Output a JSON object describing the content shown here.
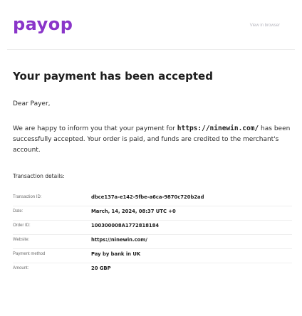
{
  "header": {
    "logo_text": "payop",
    "view_in_browser": "View in browser"
  },
  "title": "Your payment has been accepted",
  "greeting": "Dear Payer,",
  "message": {
    "part1": "We are happy to inform you that your payment for ",
    "link": "https://ninewin.com/",
    "part2": " has been successfully accepted. Your order is paid, and funds are credited to the merchant's account."
  },
  "details": {
    "title": "Transaction details:",
    "rows": [
      {
        "label": "Transaction ID:",
        "value": "dbce137a-e142-5fbe-a6ca-9870c720b2ad"
      },
      {
        "label": "Date:",
        "value": "March, 14, 2024, 08:37 UTC +0"
      },
      {
        "label": "Order ID:",
        "value": "100300008A1772818184"
      },
      {
        "label": "Website:",
        "value": "https://ninewin.com/"
      },
      {
        "label": "Payment method",
        "value": "Pay by bank in UK"
      },
      {
        "label": "Amount:",
        "value": "20 GBP"
      }
    ]
  },
  "colors": {
    "brand": "#8a35c9",
    "text": "#1d1d1d",
    "muted": "#6d6d6d"
  }
}
